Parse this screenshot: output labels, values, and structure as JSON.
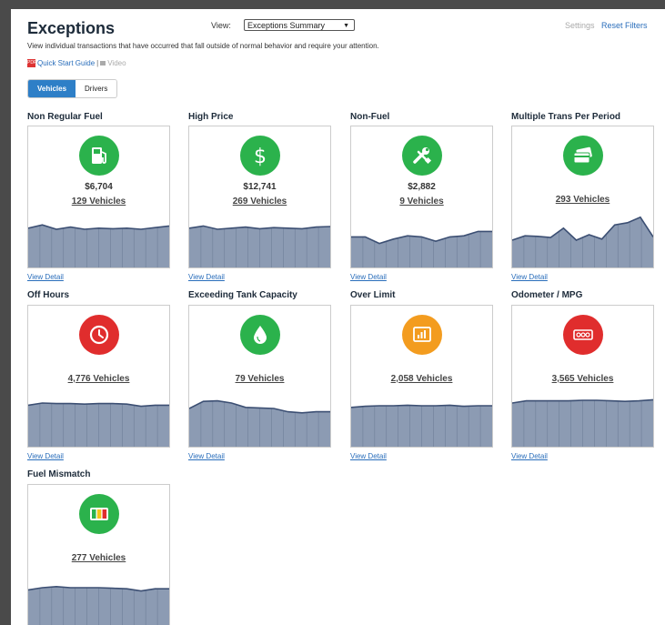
{
  "header": {
    "title": "Exceptions",
    "view_label": "View:",
    "view_value": "Exceptions Summary",
    "settings": "Settings",
    "reset_filters": "Reset Filters",
    "description": "View individual transactions that have occurred that fall outside of normal behavior and require your attention.",
    "quick_start": "Quick Start Guide",
    "separator": "|",
    "video": "Video"
  },
  "toggle": {
    "vehicles": "Vehicles",
    "drivers": "Drivers",
    "active": "Vehicles"
  },
  "view_detail_label": "View Detail",
  "cards": [
    {
      "title": "Non Regular Fuel",
      "icon": "fuel-pump-icon",
      "color": "#2bb24c",
      "amount": "$6,704",
      "count": "129 Vehicles",
      "trend": [
        0.72,
        0.78,
        0.7,
        0.74,
        0.7,
        0.72,
        0.71,
        0.72,
        0.7,
        0.73,
        0.76
      ]
    },
    {
      "title": "High Price",
      "icon": "dollar-icon",
      "color": "#2bb24c",
      "amount": "$12,741",
      "count": "269 Vehicles",
      "trend": [
        0.72,
        0.76,
        0.7,
        0.72,
        0.74,
        0.71,
        0.73,
        0.72,
        0.71,
        0.74,
        0.75
      ]
    },
    {
      "title": "Non-Fuel",
      "icon": "wrench-icon",
      "color": "#2bb24c",
      "amount": "$2,882",
      "count": "9 Vehicles",
      "trend": [
        0.56,
        0.56,
        0.44,
        0.52,
        0.58,
        0.56,
        0.48,
        0.56,
        0.58,
        0.66,
        0.66
      ]
    },
    {
      "title": "Multiple Trans Per Period",
      "icon": "credit-card-icon",
      "color": "#2bb24c",
      "amount": "",
      "count": "293 Vehicles",
      "trend": [
        0.5,
        0.58,
        0.57,
        0.55,
        0.72,
        0.5,
        0.6,
        0.52,
        0.78,
        0.82,
        0.92,
        0.56
      ]
    },
    {
      "title": "Off Hours",
      "icon": "clock-icon",
      "color": "#e02d2d",
      "amount": "",
      "count": "4,776 Vehicles",
      "trend": [
        0.76,
        0.8,
        0.79,
        0.79,
        0.78,
        0.79,
        0.79,
        0.78,
        0.74,
        0.76,
        0.76
      ]
    },
    {
      "title": "Exceeding Tank Capacity",
      "icon": "droplet-icon",
      "color": "#2bb24c",
      "amount": "",
      "count": "79 Vehicles",
      "trend": [
        0.7,
        0.83,
        0.84,
        0.8,
        0.72,
        0.71,
        0.7,
        0.64,
        0.62,
        0.64,
        0.64
      ]
    },
    {
      "title": "Over Limit",
      "icon": "bar-chart-icon",
      "color": "#f39c1f",
      "amount": "",
      "count": "2,058 Vehicles",
      "trend": [
        0.72,
        0.74,
        0.75,
        0.75,
        0.76,
        0.75,
        0.75,
        0.76,
        0.74,
        0.75,
        0.75
      ]
    },
    {
      "title": "Odometer / MPG",
      "icon": "odometer-icon",
      "color": "#e02d2d",
      "amount": "",
      "count": "3,565 Vehicles",
      "trend": [
        0.8,
        0.84,
        0.84,
        0.84,
        0.84,
        0.85,
        0.85,
        0.84,
        0.83,
        0.84,
        0.86
      ]
    },
    {
      "title": "Fuel Mismatch",
      "icon": "fuel-gauge-bars-icon",
      "color": "#2bb24c",
      "amount": "",
      "count": "277 Vehicles",
      "trend": [
        0.66,
        0.7,
        0.72,
        0.7,
        0.7,
        0.7,
        0.69,
        0.68,
        0.64,
        0.68,
        0.68
      ]
    }
  ]
}
